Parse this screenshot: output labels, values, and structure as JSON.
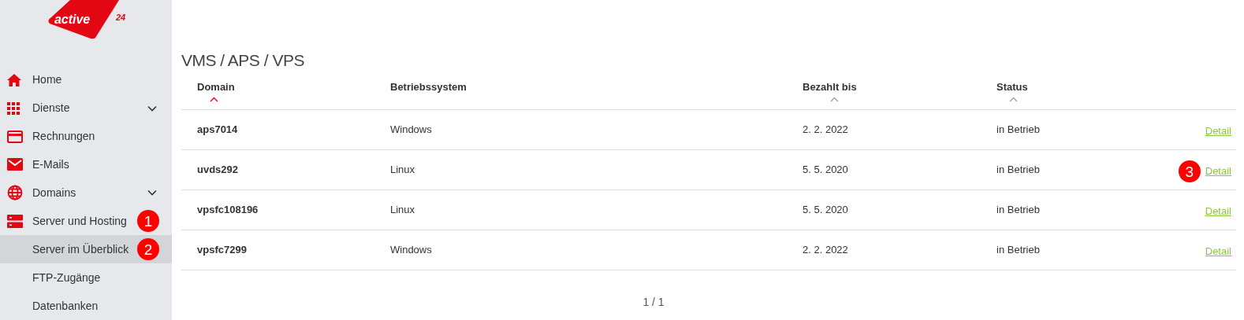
{
  "logo": {
    "word": "active",
    "number": "24"
  },
  "sidebar": {
    "items": [
      {
        "kind": "item",
        "label": "Home",
        "expandable": false,
        "selected": false
      },
      {
        "kind": "item",
        "label": "Dienste",
        "expandable": true,
        "selected": false
      },
      {
        "kind": "item",
        "label": "Rechnungen",
        "expandable": false,
        "selected": false
      },
      {
        "kind": "item",
        "label": "E-Mails",
        "expandable": false,
        "selected": false
      },
      {
        "kind": "item",
        "label": "Domains",
        "expandable": true,
        "selected": false
      },
      {
        "kind": "item",
        "label": "Server und Hosting",
        "expandable": false,
        "selected": false,
        "marker": "1"
      },
      {
        "kind": "subitem",
        "label": "Server im Überblick",
        "selected": true,
        "marker": "2"
      },
      {
        "kind": "subitem",
        "label": "FTP-Zugänge",
        "selected": false
      },
      {
        "kind": "subitem",
        "label": "Datenbanken",
        "selected": false
      }
    ]
  },
  "title": "VMS / APS / VPS",
  "table": {
    "columns": [
      {
        "label": "Domain",
        "sorted": true
      },
      {
        "label": "Betriebssystem"
      },
      {
        "label": "Bezahlt bis",
        "sorted": false
      },
      {
        "label": "Status",
        "sorted": false
      }
    ],
    "rows": [
      {
        "domain": "aps7014",
        "os": "Windows",
        "paid_until": "2. 2. 2022",
        "status": "in Betrieb",
        "action": "Detail"
      },
      {
        "domain": "uvds292",
        "os": "Linux",
        "paid_until": "5. 5. 2020",
        "status": "in Betrieb",
        "action": "Detail",
        "marker": "3"
      },
      {
        "domain": "vpsfc108196",
        "os": "Linux",
        "paid_until": "5. 5. 2020",
        "status": "in Betrieb",
        "action": "Detail"
      },
      {
        "domain": "vpsfc7299",
        "os": "Windows",
        "paid_until": "2. 2. 2022",
        "status": "in Betrieb",
        "action": "Detail"
      }
    ]
  },
  "pagination": "1 / 1"
}
